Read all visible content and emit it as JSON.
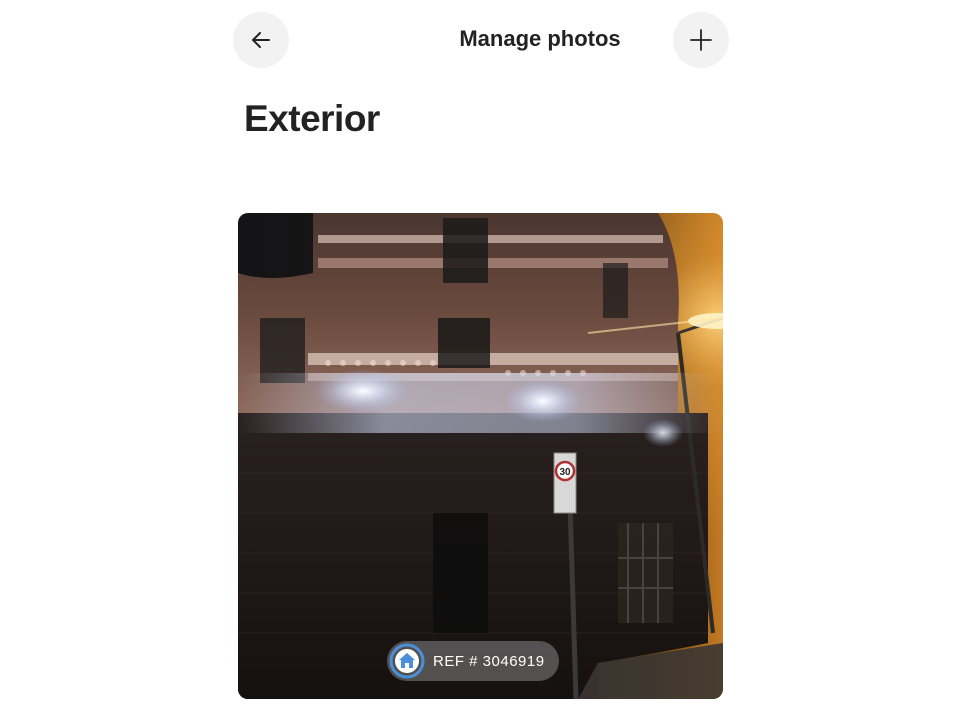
{
  "header": {
    "title": "Manage photos",
    "back_icon": "arrow-left-icon",
    "add_icon": "plus-icon"
  },
  "section": {
    "title": "Exterior"
  },
  "photo": {
    "subject": "brick building exterior at night",
    "badge_text": "REF # 3046919",
    "sign_text": "30"
  },
  "colors": {
    "text": "#222222",
    "button_bg": "#f2f2f2",
    "badge_ring": "#4a90d9"
  }
}
